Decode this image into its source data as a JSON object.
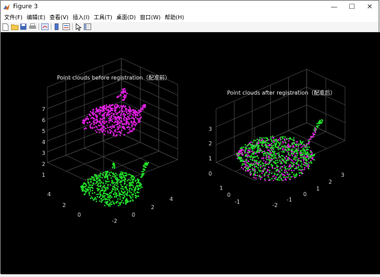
{
  "window": {
    "title": "Figure 3",
    "controls": {
      "minimize": "—",
      "maximize": "☐",
      "close": "✕"
    }
  },
  "menubar": {
    "items": [
      "文件(F)",
      "编辑(E)",
      "查看(V)",
      "插入(I)",
      "工具(T)",
      "桌面(D)",
      "窗口(W)",
      "帮助(H)"
    ]
  },
  "toolbar": {
    "buttons": [
      "new-figure-icon",
      "open-file-icon",
      "save-icon",
      "print-icon",
      "link-plot-icon",
      "insert-colorbar-icon",
      "insert-legend-icon",
      "pointer-icon",
      "plot-tools-icon"
    ]
  },
  "plots": {
    "left": {
      "title": "Point clouds before registration（配准前）",
      "z_ticks": [
        "7",
        "6",
        "5",
        "4",
        "3",
        "2",
        "1"
      ],
      "y_ticks": [
        "4",
        "2",
        "0"
      ],
      "x_ticks": [
        "-2",
        "0",
        "2",
        "4"
      ]
    },
    "right": {
      "title": "Point clouds after registration（配准后）",
      "z_ticks": [
        "3",
        "2",
        "1",
        "0"
      ],
      "y_ticks": [
        "1",
        "0",
        "-1"
      ],
      "x_ticks": [
        "-2",
        "-1",
        "0",
        "1",
        "2",
        "3"
      ]
    }
  },
  "colors": {
    "source_cloud": "#e020e0",
    "target_cloud": "#22e02a",
    "axes_grid": "#5a5a5a",
    "figure_background": "#000000"
  }
}
